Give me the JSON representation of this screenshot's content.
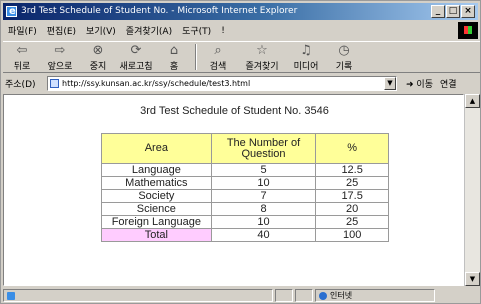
{
  "window": {
    "title": "3rd Test Schedule of Student No. - Microsoft Internet Explorer",
    "buttons": {
      "minimize": "_",
      "maximize": "□",
      "close": "×"
    }
  },
  "menu": [
    "파일(F)",
    "편집(E)",
    "보기(V)",
    "즐겨찾기(A)",
    "도구(T)",
    "!"
  ],
  "toolbar": {
    "back": "뒤로",
    "forward": "앞으로",
    "stop": "중지",
    "refresh": "새로고침",
    "home": "홈",
    "search": "검색",
    "favorites": "즐겨찾기",
    "media": "미디어",
    "history": "기록"
  },
  "address": {
    "label": "주소(D)",
    "url": "http://ssy.kunsan.ac.kr/ssy/schedule/test3.html",
    "go": "이동",
    "links": "연결"
  },
  "page": {
    "heading": "3rd Test Schedule of Student No. 3546",
    "headers": {
      "area": "Area",
      "number": "The Number of Question",
      "percent": "%"
    },
    "rows": [
      {
        "area": "Language",
        "number": "5",
        "percent": "12.5"
      },
      {
        "area": "Mathematics",
        "number": "10",
        "percent": "25"
      },
      {
        "area": "Society",
        "number": "7",
        "percent": "17.5"
      },
      {
        "area": "Science",
        "number": "8",
        "percent": "20"
      },
      {
        "area": "Foreign Language",
        "number": "10",
        "percent": "25"
      }
    ],
    "total": {
      "area": "Total",
      "number": "40",
      "percent": "100"
    }
  },
  "status": {
    "zone": "인터넷"
  },
  "colors": {
    "header_bg": "#ffff99",
    "total_bg": "#ffccff",
    "titlebar": "#0a246a"
  }
}
